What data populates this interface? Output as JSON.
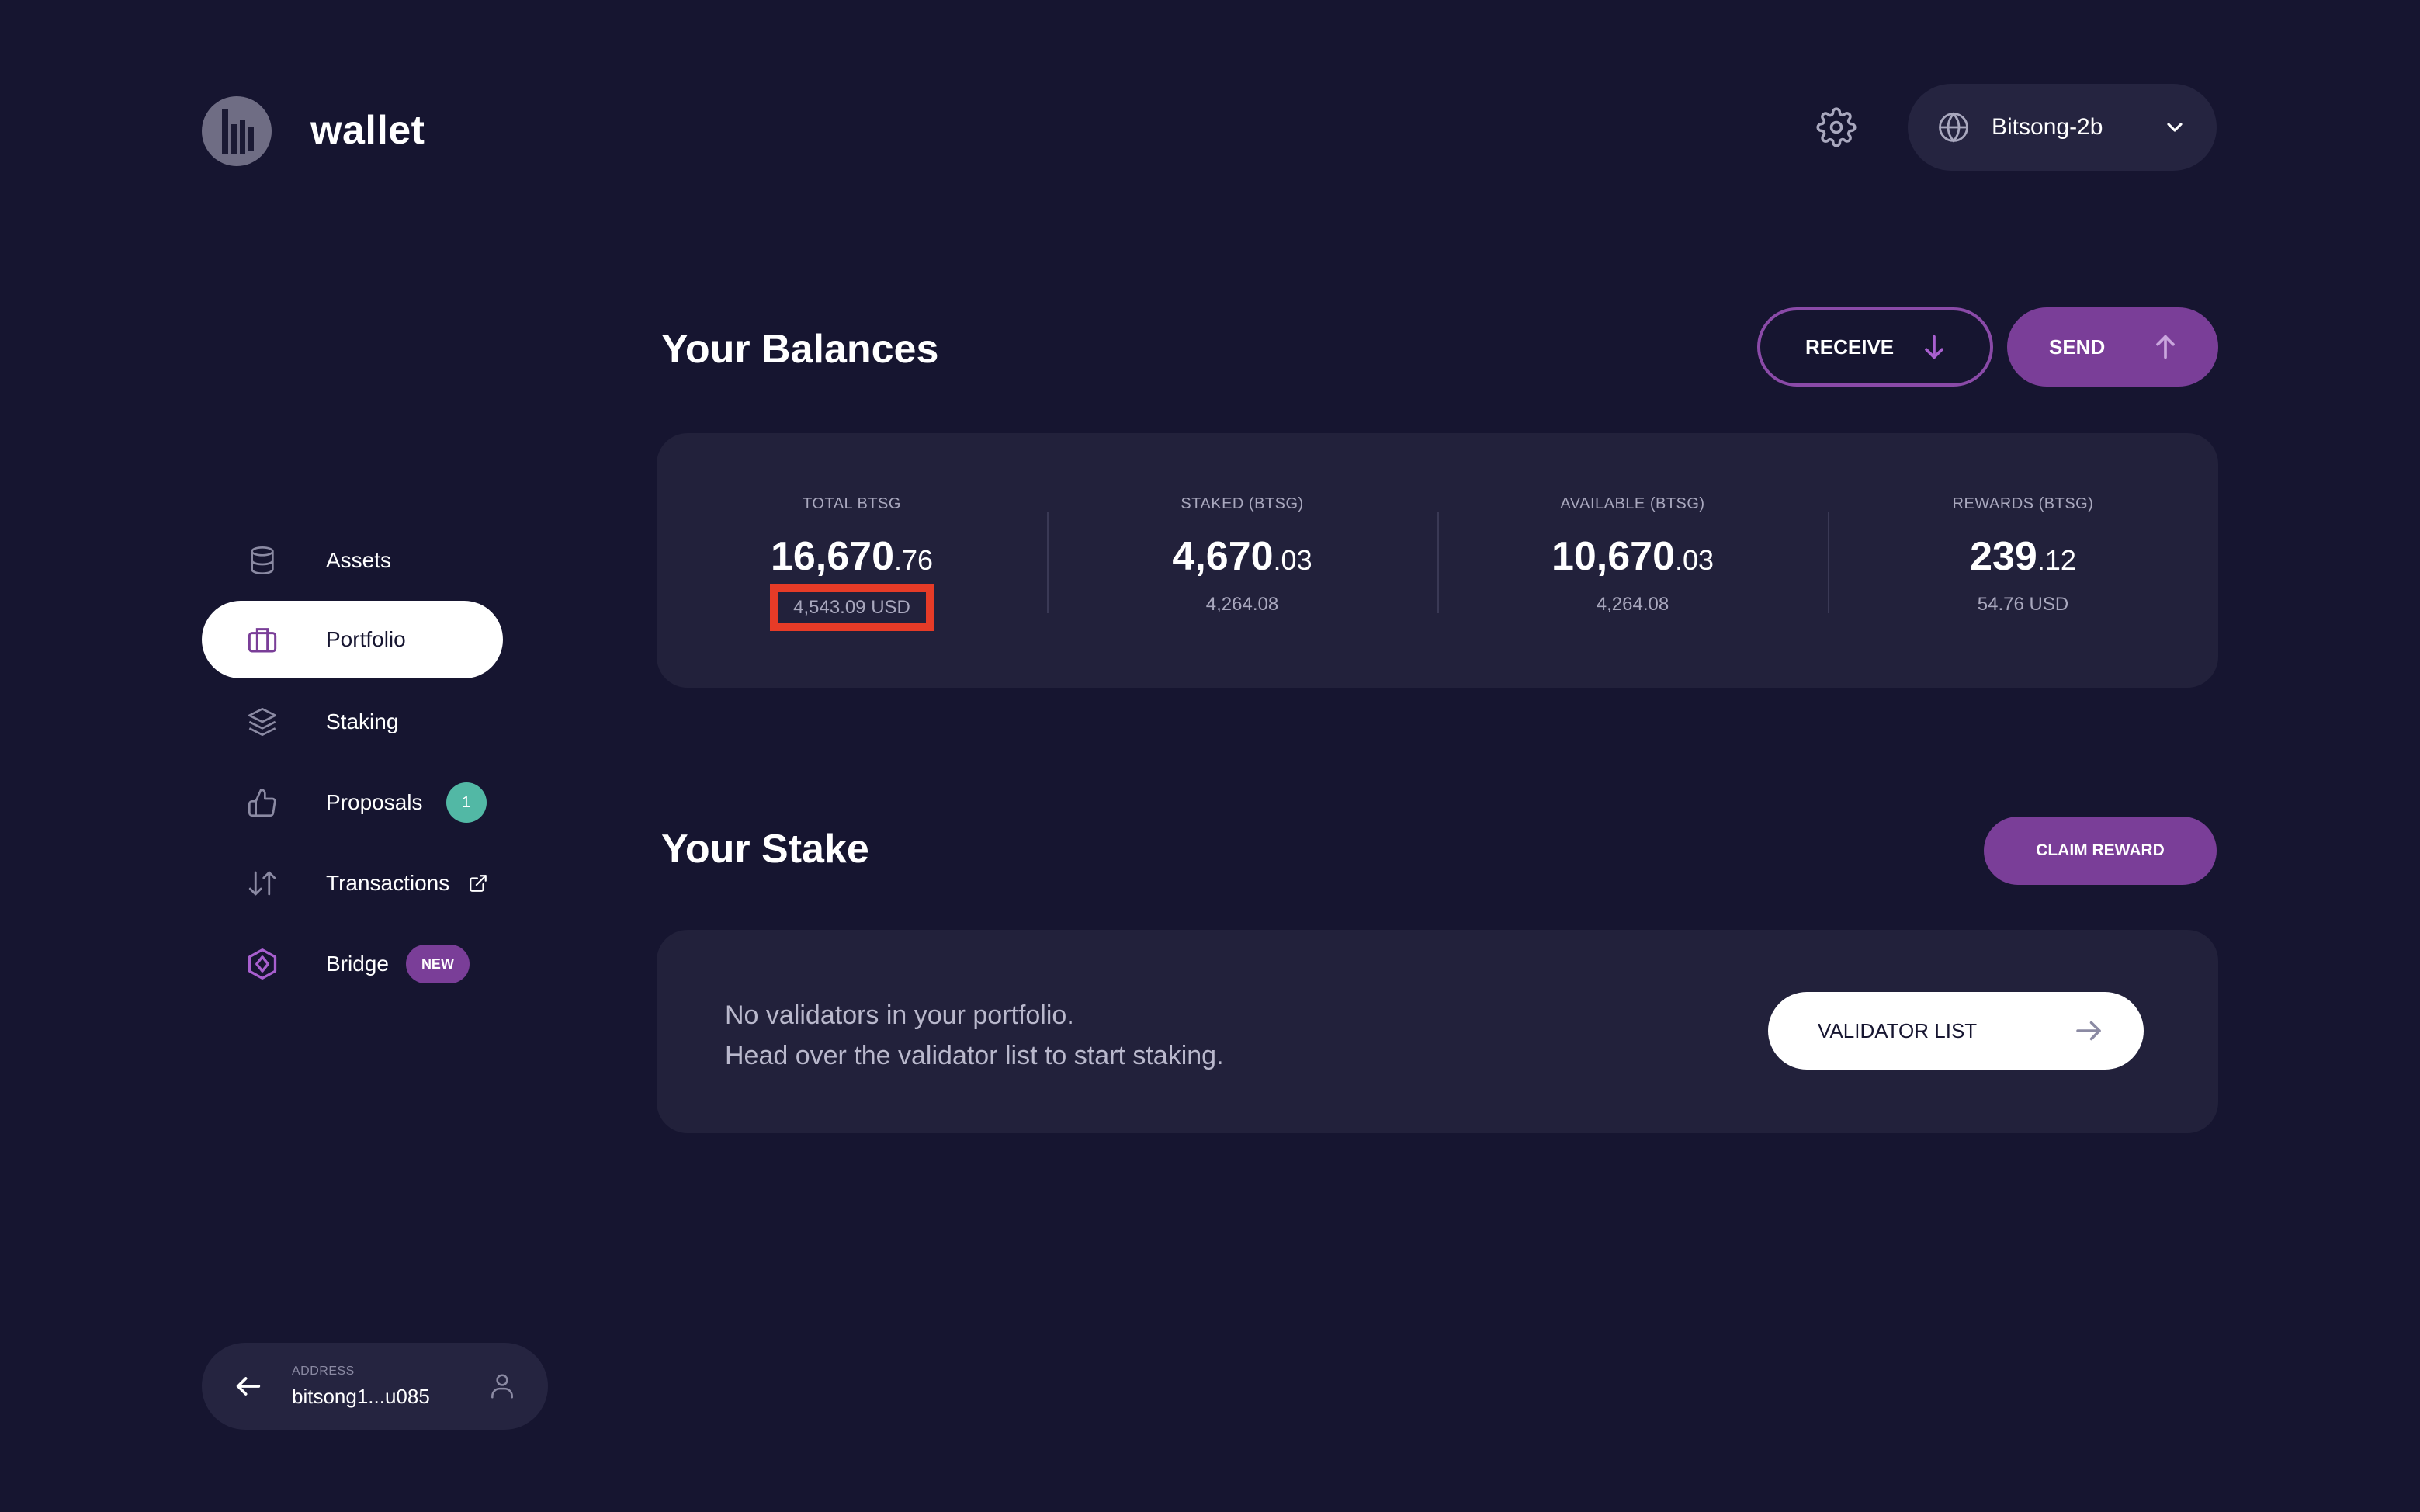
{
  "app": {
    "logo_text": "wallet",
    "network_label": "Bitsong-2b"
  },
  "sidebar": {
    "items": [
      {
        "label": "Assets",
        "icon": "database-icon",
        "active": false
      },
      {
        "label": "Portfolio",
        "icon": "briefcase-icon",
        "active": true
      },
      {
        "label": "Staking",
        "icon": "layers-icon",
        "active": false
      },
      {
        "label": "Proposals",
        "icon": "thumbs-up-icon",
        "active": false,
        "badge": "1"
      },
      {
        "label": "Transactions",
        "icon": "transfer-arrows-icon",
        "active": false,
        "external": true
      },
      {
        "label": "Bridge",
        "icon": "bridge-icon",
        "active": false,
        "badge": "NEW"
      }
    ],
    "address": {
      "caption": "ADDRESS",
      "value": "bitsong1...u085"
    }
  },
  "balances": {
    "title": "Your Balances",
    "receive_label": "RECEIVE",
    "send_label": "SEND",
    "columns": [
      {
        "label": "TOTAL BTSG",
        "int": "16,670",
        "dec": ".76",
        "sub": "4,543.09 USD",
        "highlighted": true
      },
      {
        "label": "STAKED (BTSG)",
        "int": "4,670",
        "dec": ".03",
        "sub": "4,264.08"
      },
      {
        "label": "AVAILABLE (BTSG)",
        "int": "10,670",
        "dec": ".03",
        "sub": "4,264.08"
      },
      {
        "label": "REWARDS (BTSG)",
        "int": "239",
        "dec": ".12",
        "sub": "54.76 USD"
      }
    ]
  },
  "stake": {
    "title": "Your Stake",
    "claim_label": "CLAIM REWARD",
    "empty_line1": "No validators in your portfolio.",
    "empty_line2": "Head over the validator list to start staking.",
    "validator_list_label": "VALIDATOR LIST"
  },
  "colors": {
    "background": "#161530",
    "card": "#22213b",
    "accent_purple": "#7a3e98",
    "badge_teal": "#52b8a5",
    "highlight_red": "#e63b27"
  }
}
